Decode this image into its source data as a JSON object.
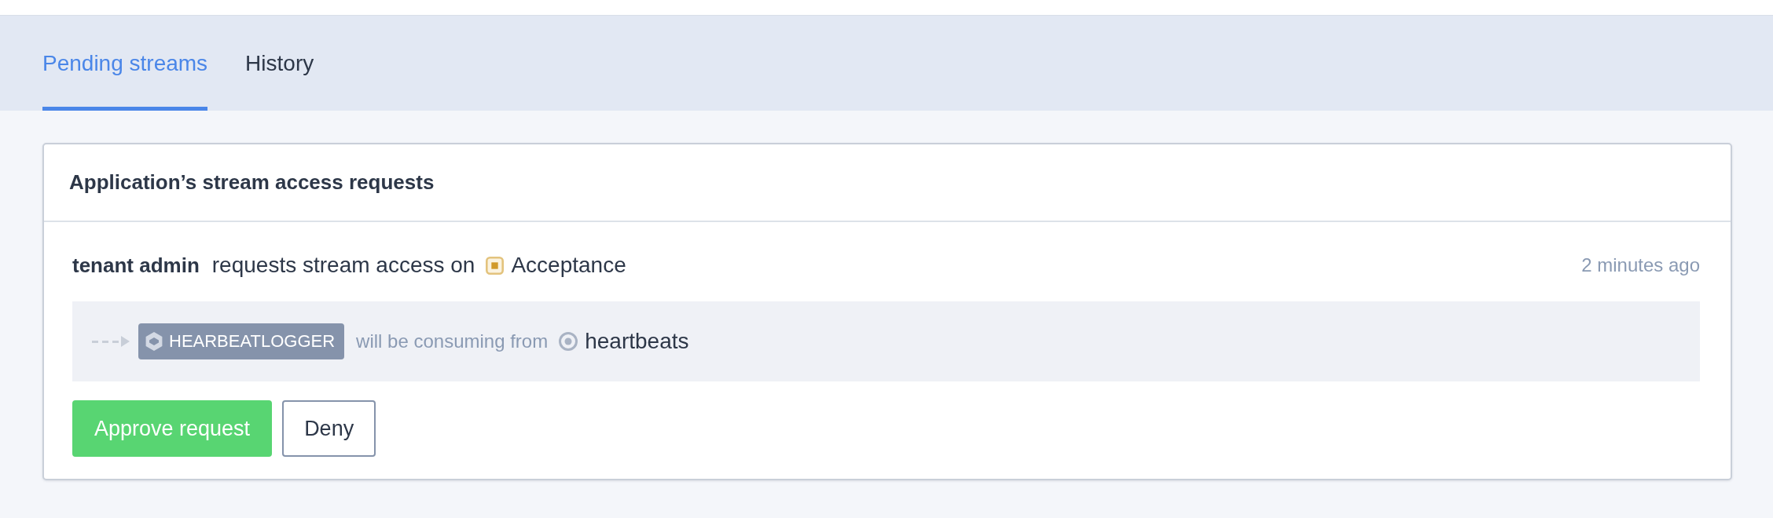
{
  "tabs": [
    {
      "label": "Pending streams",
      "selected": true
    },
    {
      "label": "History",
      "selected": false
    }
  ],
  "panel": {
    "title": "Application’s stream access requests",
    "requests": [
      {
        "requester": "tenant admin",
        "action": "requests stream access on",
        "environment": "Acceptance",
        "time": "2 minutes ago",
        "application": "HEARBEATLOGGER",
        "relation": "will be consuming from",
        "stream": "heartbeats",
        "buttons": [
          {
            "label": "Approve request",
            "kind": "primary"
          },
          {
            "label": "Deny",
            "kind": "secondary"
          }
        ]
      }
    ]
  }
}
